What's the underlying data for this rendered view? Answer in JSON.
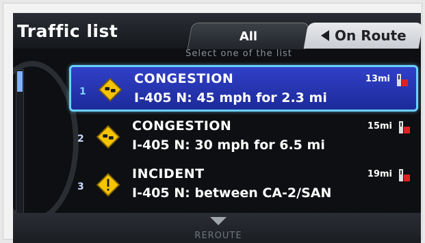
{
  "screen": {
    "title": "Traffic list"
  },
  "tabs": {
    "all": "All",
    "on_route": "On Route"
  },
  "hint": "Select one of the list",
  "incidents": [
    {
      "index": "1",
      "type": "CONGESTION",
      "distance": "13mi",
      "description": "I-405 N: 45 mph for 2.3 mi",
      "icon": "congestion-icon"
    },
    {
      "index": "2",
      "type": "CONGESTION",
      "distance": "15mi",
      "description": "I-405 N: 30 mph for 6.5 mi",
      "icon": "congestion-icon"
    },
    {
      "index": "3",
      "type": "INCIDENT",
      "distance": "19mi",
      "description": "I-405 N: between CA-2/SAN",
      "icon": "incident-icon"
    }
  ],
  "footer": {
    "reroute": "REROUTE"
  },
  "colors": {
    "selected_row": "#2434b8",
    "selected_border": "#6ad1ff",
    "warning_yellow": "#f5c400"
  }
}
